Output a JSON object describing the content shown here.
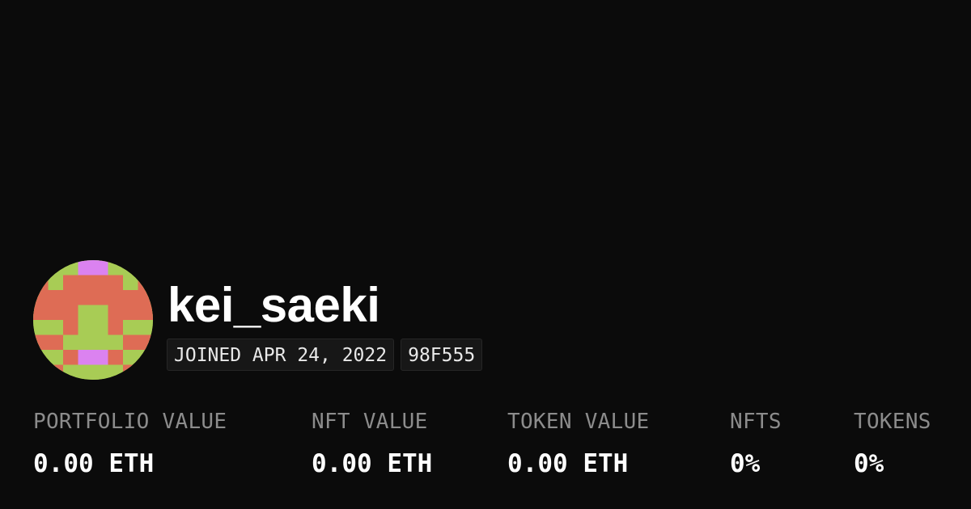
{
  "profile": {
    "username": "kei_saeki",
    "joined": "JOINED APR 24, 2022",
    "address_short": "98F555",
    "avatar_colors": {
      "green": "#a8cc55",
      "orange": "#de6c55",
      "pink": "#db82f0"
    }
  },
  "stats": [
    {
      "label": "PORTFOLIO VALUE",
      "value": "0.00 ETH"
    },
    {
      "label": "NFT VALUE",
      "value": "0.00 ETH"
    },
    {
      "label": "TOKEN VALUE",
      "value": "0.00 ETH"
    },
    {
      "label": "NFTS",
      "value": "0%"
    },
    {
      "label": "TOKENS",
      "value": "0%"
    }
  ]
}
